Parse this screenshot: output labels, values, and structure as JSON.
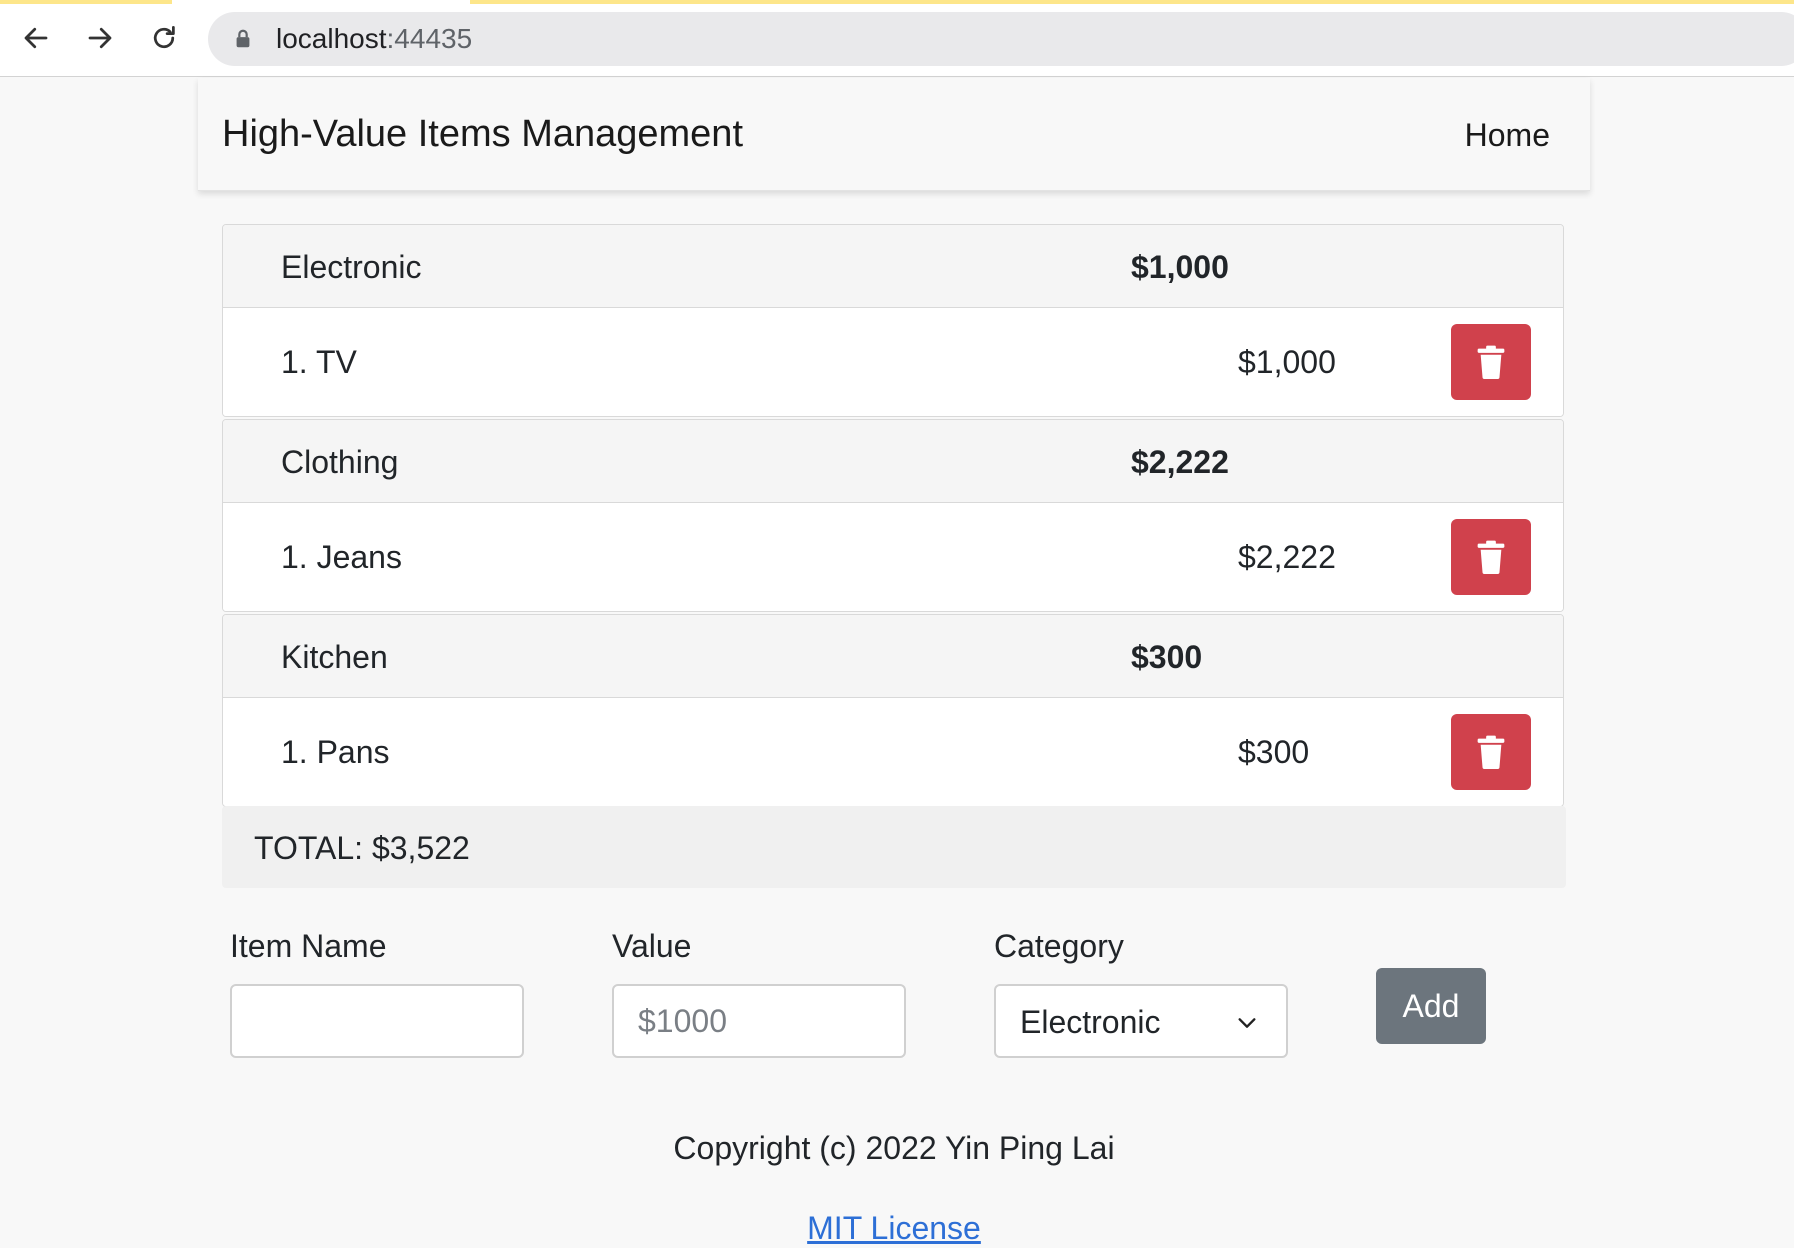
{
  "browser": {
    "url_host": "localhost",
    "url_port": ":44435"
  },
  "navbar": {
    "brand": "High-Value Items Management",
    "home_link": "Home"
  },
  "categories": [
    {
      "name": "Electronic",
      "total": "$1,000",
      "items": [
        {
          "name": "1. TV",
          "value": "$1,000"
        }
      ]
    },
    {
      "name": "Clothing",
      "total": "$2,222",
      "items": [
        {
          "name": "1. Jeans",
          "value": "$2,222"
        }
      ]
    },
    {
      "name": "Kitchen",
      "total": "$300",
      "items": [
        {
          "name": "1. Pans",
          "value": "$300"
        }
      ]
    }
  ],
  "total_text": "TOTAL: $3,522",
  "form": {
    "item_name_label": "Item Name",
    "item_name_value": "",
    "value_label": "Value",
    "value_placeholder": "$1000",
    "category_label": "Category",
    "category_selected": "Electronic",
    "add_label": "Add"
  },
  "footer": {
    "copyright": "Copyright (c) 2022 Yin Ping Lai",
    "license": "MIT License"
  },
  "colors": {
    "delete_button": "#d0414c",
    "add_button": "#6c757d",
    "link": "#2d6fd6",
    "tab_accent": "#fde68a"
  },
  "icons": {
    "back": "arrow-left-icon",
    "forward": "arrow-right-icon",
    "reload": "reload-icon",
    "lock": "lock-icon",
    "delete": "trash-icon",
    "dropdown": "chevron-down-icon"
  }
}
